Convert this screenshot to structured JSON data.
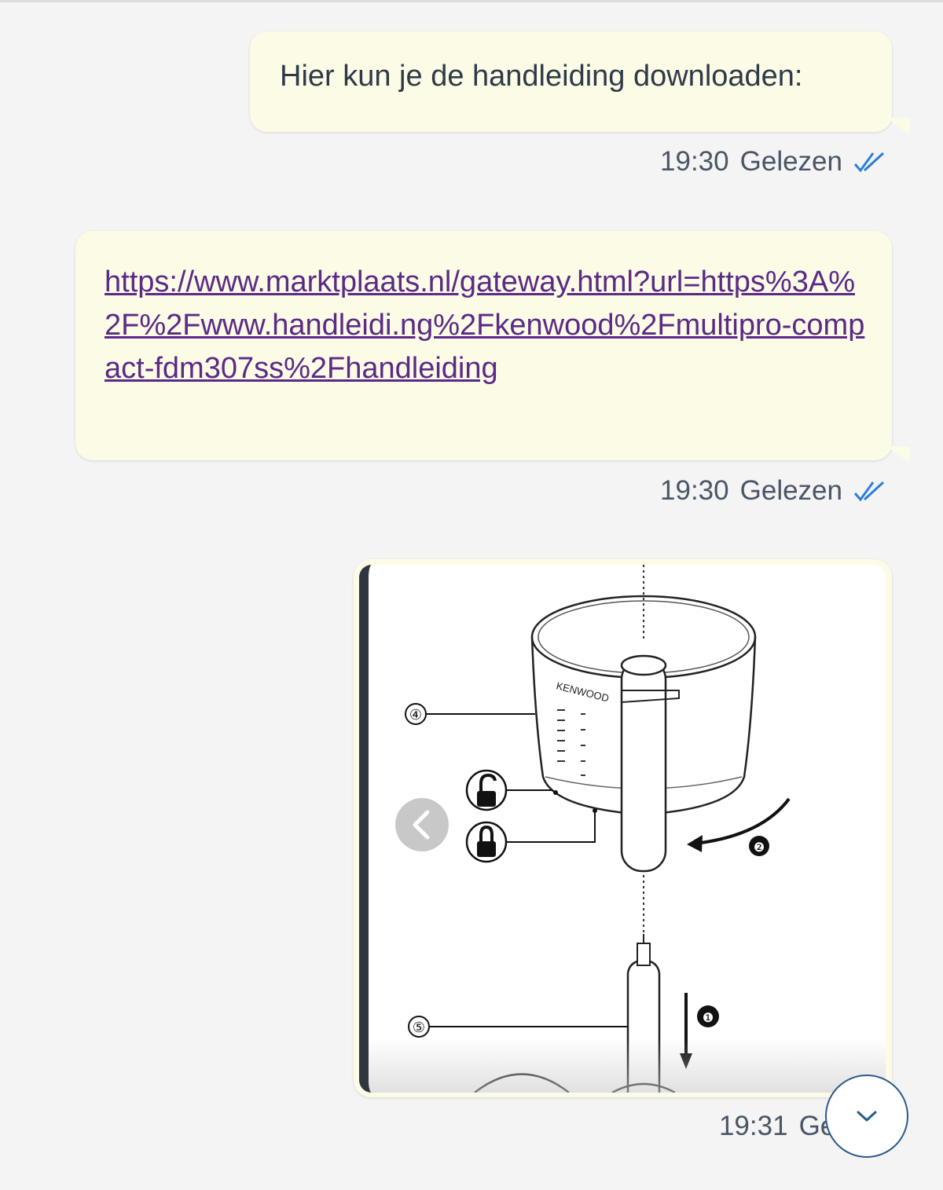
{
  "messages": [
    {
      "type": "text",
      "text": "Hier kun je de handleiding downloaden:",
      "time": "19:30",
      "status": "Gelezen"
    },
    {
      "type": "link",
      "text": "https://www.marktplaats.nl/gateway.html?url=https%3A%2F%2Fwww.handleidi.ng%2Fkenwood%2Fmultipro-compact-fdm307ss%2Fhandleiding",
      "time": "19:30",
      "status": "Gelezen"
    },
    {
      "type": "image",
      "image_labels": {
        "brand": "KENWOOD",
        "part_4": "④",
        "part_5": "⑤",
        "step_1": "❶",
        "step_2": "❷"
      },
      "time": "19:31",
      "status": "Gelez"
    }
  ],
  "icons": {
    "read_receipt": "double-check-icon",
    "prev": "chevron-left-icon",
    "scroll_down": "chevron-down-icon"
  },
  "colors": {
    "bubble": "#fcfbe6",
    "link": "#5b2a86",
    "read_check": "#2a7fd6",
    "scroll_button_border": "#2a5a8c"
  }
}
